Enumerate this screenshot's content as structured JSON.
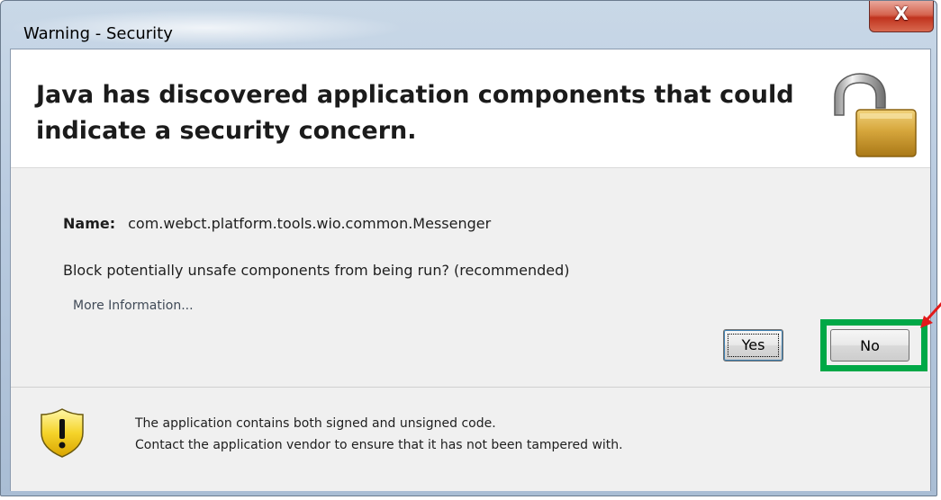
{
  "window": {
    "title": "Warning - Security",
    "close_glyph": "X"
  },
  "header": {
    "title": "Java has discovered application components that could indicate a security concern.",
    "icon": "padlock-open-icon"
  },
  "body": {
    "name_label": "Name:",
    "name_value": "com.webct.platform.tools.wio.common.Messenger",
    "question": "Block potentially unsafe components from being run? (recommended)",
    "more_info_link": "More Information..."
  },
  "buttons": {
    "yes_label": "Yes",
    "no_label": "No"
  },
  "footer": {
    "icon": "warning-shield-icon",
    "line1": "The application contains both signed and unsigned code.",
    "line2": "Contact the application vendor to ensure that it has not been tampered with."
  },
  "annotation": {
    "highlight_color": "#00a847",
    "arrow_color": "#e21a1a",
    "target": "no-button"
  }
}
